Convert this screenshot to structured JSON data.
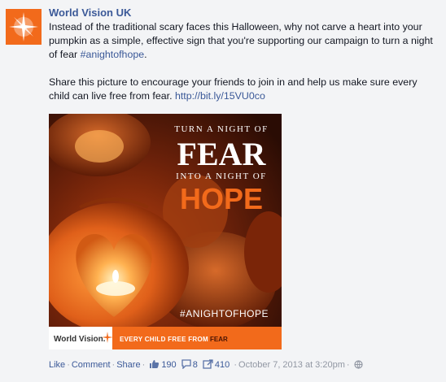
{
  "post": {
    "page_name": "World Vision UK",
    "text_line1": "Instead of the traditional scary faces this Halloween, why not carve a heart into your pumpkin as a simple, effective sign that you're supporting our campaign to turn a night of fear ",
    "hashtag": "#anightofhope",
    "text_line1_end": ".",
    "text_line2": "Share this picture to encourage your friends to join in and help us make sure every child can live free from fear. ",
    "short_link": "http://bit.ly/15VU0co"
  },
  "image": {
    "headline_top": "Turn a night of",
    "headline_fear": "FEAR",
    "headline_middle": "into a night of",
    "headline_hope": "HOPE",
    "hashtag": "#ANIGHTOFHOPE",
    "brand": "World Vision.",
    "banner_text": "EVERY CHILD FREE FROM ",
    "banner_fear": "FEAR",
    "colors": {
      "banner": "#f26a1b",
      "hope": "#f26a1b",
      "fear_text": "#ffffff"
    }
  },
  "footer": {
    "like": "Like",
    "comment": "Comment",
    "share": "Share",
    "likes_count": "190",
    "comments_count": "8",
    "shares_count": "410",
    "timestamp": "October 7, 2013 at 3:20pm",
    "icons": [
      "thumbs-up-icon",
      "comment-bubble-icon",
      "share-icon",
      "globe-icon"
    ]
  }
}
